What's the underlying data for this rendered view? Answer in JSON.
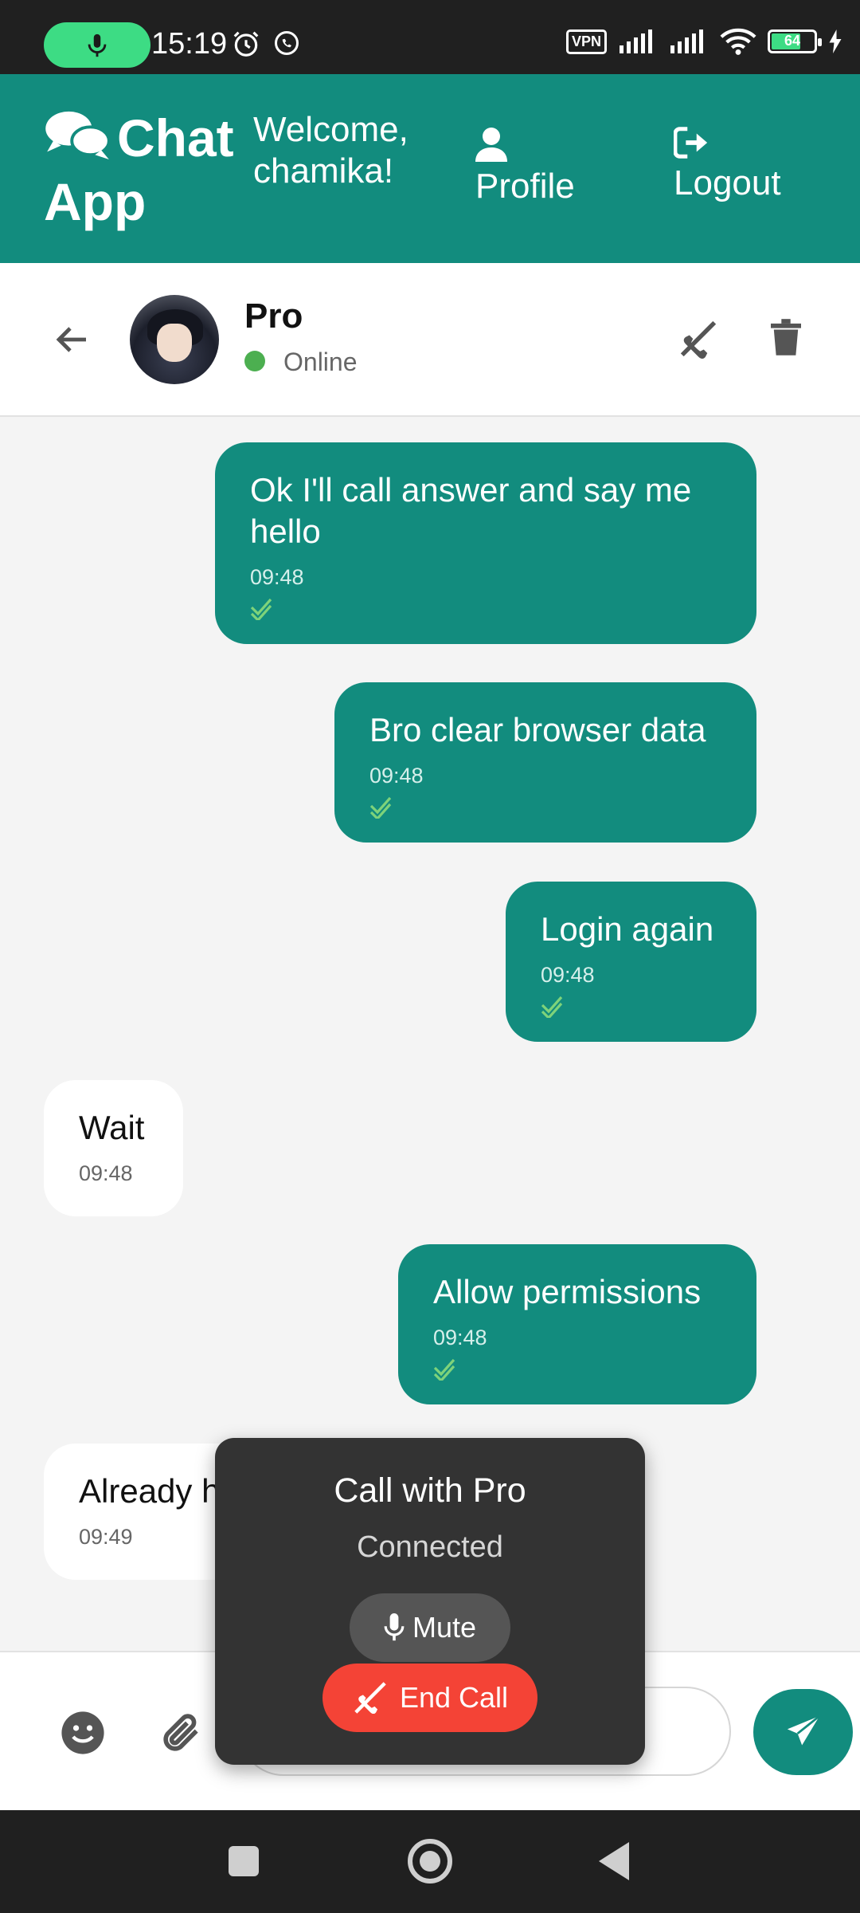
{
  "status_bar": {
    "time": "15:19",
    "vpn": "VPN",
    "battery": "64",
    "icons": [
      "mic-icon",
      "alarm-icon",
      "whatsapp-icon",
      "vpn-icon",
      "signal-icon",
      "signal-icon",
      "wifi-icon",
      "battery-icon",
      "charging-icon"
    ]
  },
  "app_header": {
    "brand": "Chat App",
    "welcome": "Welcome, chamika!",
    "profile_label": "Profile",
    "logout_label": "Logout",
    "color": "#128c7e"
  },
  "chat_header": {
    "contact_name": "Pro",
    "status": "Online",
    "status_color": "#4caf50"
  },
  "messages": [
    {
      "direction": "sent",
      "text": "Ok I'll call answer and say me hello",
      "time": "09:48",
      "read": true
    },
    {
      "direction": "sent",
      "text": "Bro clear browser data",
      "time": "09:48",
      "read": true
    },
    {
      "direction": "sent",
      "text": "Login again",
      "time": "09:48",
      "read": true
    },
    {
      "direction": "received",
      "text": "Wait",
      "time": "09:48"
    },
    {
      "direction": "sent",
      "text": "Allow permissions",
      "time": "09:48",
      "read": true
    },
    {
      "direction": "received",
      "text": "Already h",
      "time": "09:49"
    }
  ],
  "input": {
    "value": "",
    "placeholder": ""
  },
  "call": {
    "title": "Call with Pro",
    "status": "Connected",
    "mute_label": "Mute",
    "end_label": "End Call",
    "end_color": "#f44336"
  }
}
